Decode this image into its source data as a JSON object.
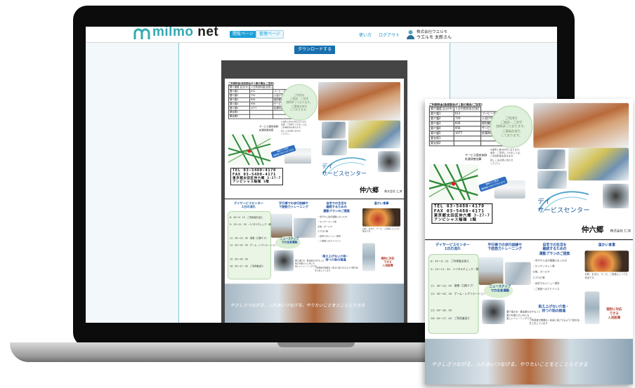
{
  "app": {
    "logo": {
      "part1": "milmo",
      "part2": "net"
    },
    "tabs": [
      {
        "label": "閲覧ページ"
      },
      {
        "label": "管理ページ"
      }
    ],
    "links": [
      {
        "label": "使い方"
      },
      {
        "label": "ログアウト"
      }
    ],
    "user": {
      "company": "株式会社ウエルモ",
      "name": "ウエルモ 太郎さん"
    },
    "download_label": "ダウンロードする"
  },
  "brochure": {
    "table": {
      "header": "ご利用料金(負担割合が１割の場合/ご目安)",
      "rows": [
        [
          "要介護度 区分(※)",
          "１日利用料金(目安)"
        ],
        [
          "要介護1",
          "612",
          "コーヒーネットワーク"
        ],
        [
          "要介護2",
          "720",
          "入浴(介助)加算"
        ],
        [
          "要介護3",
          "836",
          "個別機能訓練加算"
        ],
        [
          "要介護4",
          "956",
          "サービス提供体制"
        ],
        [
          "要介護5",
          "1077",
          "処遇改善加算"
        ],
        [
          "要支援1",
          "",
          ""
        ],
        [
          "要支援2",
          "",
          ""
        ]
      ],
      "note1": "サービス提供体制",
      "note2": "処遇改善加算"
    },
    "circle_note": "ご利用の\nご相談・ご見学\n随時承っております。\nご連絡お待ち\nしております。",
    "blurb": "※食費１食480円となります。\n食事・ご見学につきましては、\nご利用料金を除きます。\n詳しくはお問い合わせ\nください。",
    "badge": "無料でご見学\n随時受け付けております",
    "contact": {
      "tel": "TEL 03-5480-4170",
      "fax": "FAX 03-5480-4171",
      "address": "東京都太田区仲六郷 3-27-7",
      "building": "アンビシャス稲嶺 1階"
    },
    "logo_day": "デイ",
    "logo_service": "サービスセンター",
    "logo_town": "仲六郷",
    "logo_company": "株式会社 仁済",
    "schedule": {
      "title": "デイサービスセンター\n1日の流れ",
      "lines": [
        "8：45〜9：15　ご利用者お迎え",
        "9：15〜11：30　バイタルチェック・朝のご挨拶・入浴",
        "",
        "11：30〜13：00　昼食（口腔ケア）",
        "13：30〜14：30　ゲーム・レクリエーション",
        "",
        "15：00〜16：00",
        "16：00〜17：00　ご利用者送り"
      ]
    },
    "section_walk": "平行棒での歩行訓練や\n下肢筋力トレーニング",
    "section_life": "自宅での生活を\n継続するための\n運動プランのご提案",
    "section_lunch": "温かい食事",
    "section_nustep": "ニューステップ\nでの全身運動",
    "section_care": "抱え上げない介助・\n待つ介助の推進",
    "section_bath": "個別に対応\nできる\n入浴設備",
    "life_lines": [
      "・歩行や入浴が困難になった方",
      "・センサーマット等",
      "の他、ボールや",
      "エアロビ等",
      "・自宅でのメニュー提供",
      "・ご家族へのアドバイス"
    ],
    "lunch_text": "お刺、ままた、ベース、ご家族にとっても安全です。",
    "care_text": "ご利用者が無理なく安全に過ごせるよう介助方法を工夫しています",
    "nustep_text": "要介護の方・要支援の方やもっと\n筋力を鍛えたい方にも\n楽しいトレーニングです。",
    "banner_text": "やさしさつながる、ふれあいつなげる、やりたいことをとことんできる"
  }
}
